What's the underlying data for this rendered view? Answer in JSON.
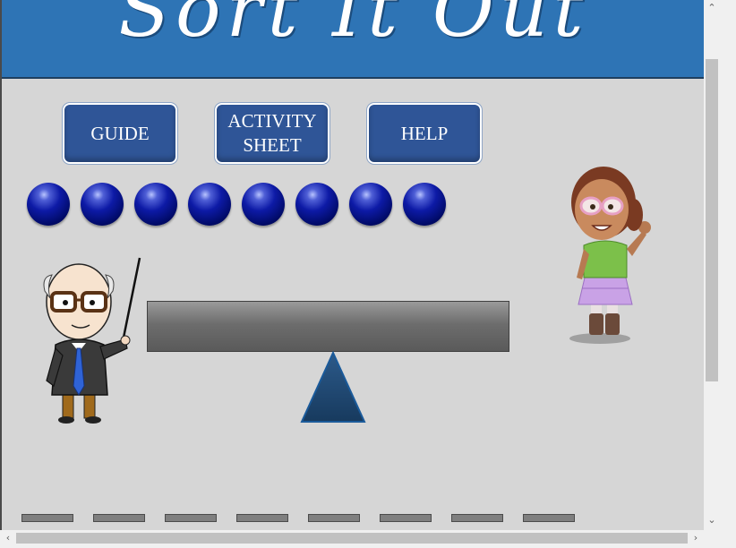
{
  "header": {
    "title": "Sort It Out"
  },
  "buttons": {
    "guide": "GUIDE",
    "activity_line1": "ACTIVITY",
    "activity_line2": "SHEET",
    "help": "HELP"
  },
  "balls": {
    "count": 8,
    "color": "#0d1aa6"
  },
  "slots": {
    "count": 8,
    "color": "#7f7f7f"
  },
  "scale": {
    "plank_color": "#6d6d6d",
    "fulcrum_color": "#1f4e79"
  },
  "characters": [
    "teacher-character",
    "girl-character"
  ],
  "scrollbars": {
    "up": "⌃",
    "down": "⌄",
    "left": "‹",
    "right": "›"
  },
  "colors": {
    "header": "#2e74b5",
    "button": "#2f5597",
    "background": "#d6d6d6"
  }
}
